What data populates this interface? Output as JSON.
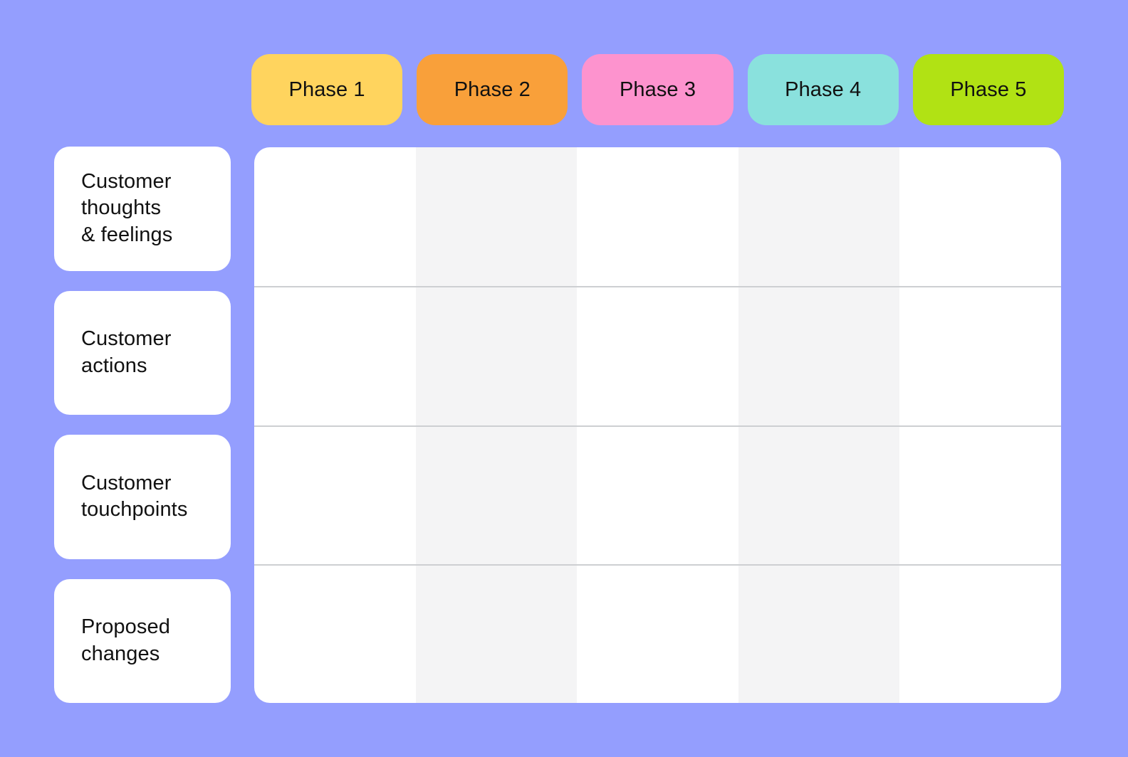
{
  "canvas": {
    "background_color": "#949efe",
    "board_type": "customer-journey-map-template"
  },
  "phases": {
    "items": [
      {
        "label": "Phase 1",
        "color": "#ffd45e"
      },
      {
        "label": "Phase 2",
        "color": "#f9a03a"
      },
      {
        "label": "Phase 3",
        "color": "#fd93ce"
      },
      {
        "label": "Phase 4",
        "color": "#8ae1dd"
      },
      {
        "label": "Phase 5",
        "color": "#b1e214"
      }
    ]
  },
  "rows": {
    "items": [
      {
        "label": "Customer\nthoughts\n& feelings"
      },
      {
        "label": "Customer\nactions"
      },
      {
        "label": "Customer\ntouchpoints"
      },
      {
        "label": "Proposed\nchanges"
      }
    ]
  },
  "grid": {
    "background_color": "#ffffff",
    "shaded_column_color": "#f4f4f5",
    "divider_color": "#cdcfd2",
    "column_count": 5,
    "row_count": 4,
    "column_shading": [
      "plain",
      "shaded",
      "plain",
      "shaded",
      "plain"
    ],
    "cells": [
      [
        "",
        "",
        "",
        "",
        ""
      ],
      [
        "",
        "",
        "",
        "",
        ""
      ],
      [
        "",
        "",
        "",
        "",
        ""
      ],
      [
        "",
        "",
        "",
        "",
        ""
      ]
    ]
  }
}
